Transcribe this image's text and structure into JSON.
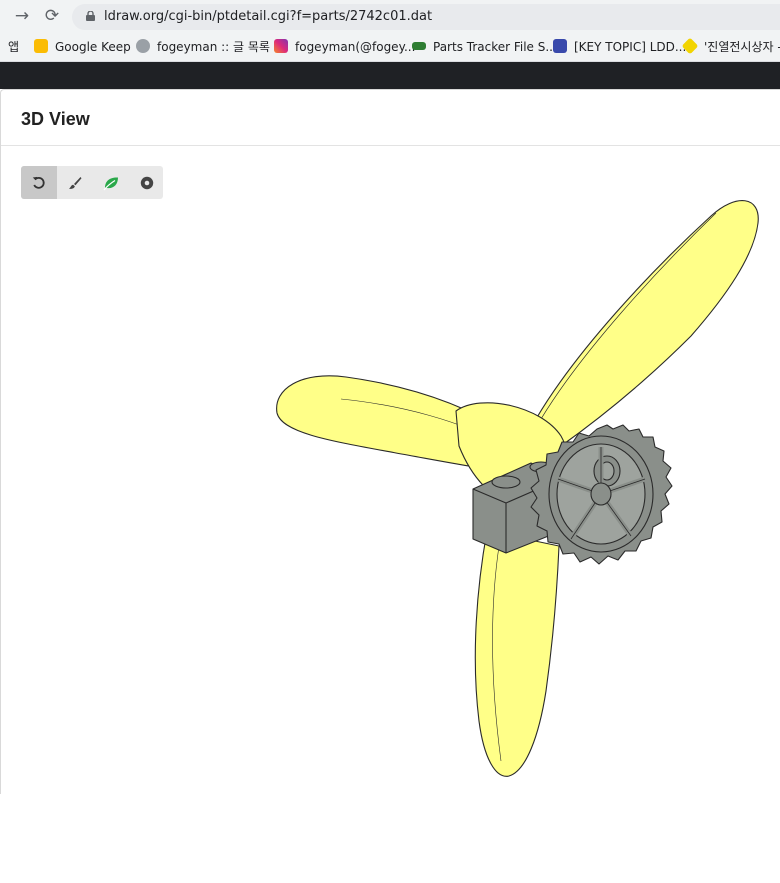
{
  "browser": {
    "url": "ldraw.org/cgi-bin/ptdetail.cgi?f=parts/2742c01.dat",
    "back_icon": "arrow-right-icon",
    "reload_icon": "reload-icon"
  },
  "bookmarks": {
    "apps_label": "앱",
    "items": [
      {
        "label": "Google Keep",
        "icon": "keep-icon",
        "color": "#fbbc04"
      },
      {
        "label": "fogeyman :: 글 목록",
        "icon": "blog-icon",
        "color": "#9aa0a6"
      },
      {
        "label": "fogeyman(@fogey...",
        "icon": "instagram-icon",
        "color": "#c13584"
      },
      {
        "label": "Parts Tracker File S...",
        "icon": "parts-tracker-icon",
        "color": "#2e7d32"
      },
      {
        "label": "[KEY TOPIC] LDD...",
        "icon": "ldd-icon",
        "color": "#3949ab"
      },
      {
        "label": "'진열전시상자 -",
        "icon": "box-icon",
        "color": "#f2d400"
      }
    ]
  },
  "panel": {
    "title": "3D View"
  },
  "toolbar": {
    "buttons": [
      {
        "name": "reset-view-button",
        "icon": "undo-icon"
      },
      {
        "name": "color-button",
        "icon": "brush-icon"
      },
      {
        "name": "eco-button",
        "icon": "leaf-icon",
        "color": "#2aa84a"
      },
      {
        "name": "dot-button",
        "icon": "circle-dot-icon"
      }
    ]
  },
  "model": {
    "part": "2742c01",
    "blade_color": "#ffff88",
    "gear_color": "#8a8f8a"
  }
}
